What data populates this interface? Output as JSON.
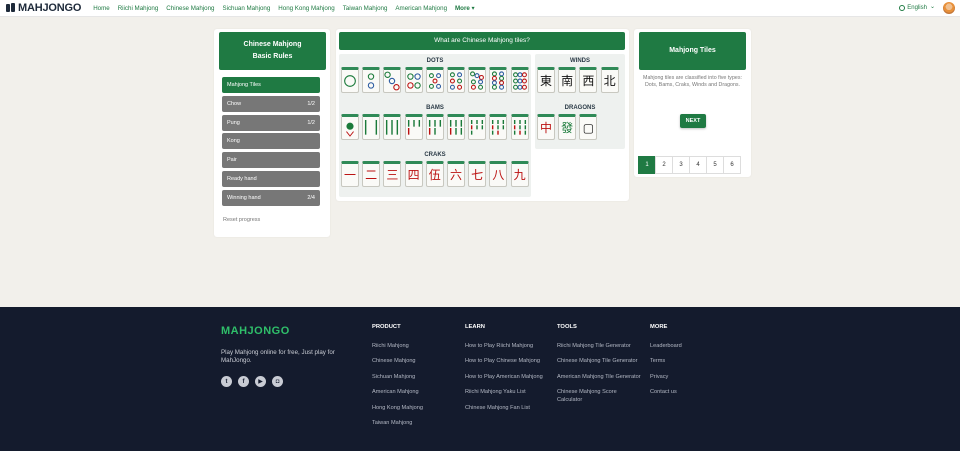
{
  "nav": {
    "brand": "MAHJONGO",
    "links": [
      "Home",
      "Riichi Mahjong",
      "Chinese Mahjong",
      "Sichuan Mahjong",
      "Hong Kong Mahjong",
      "Taiwan Mahjong",
      "American Mahjong",
      "More ▾"
    ],
    "language": "English",
    "language_arrow": "⌄"
  },
  "left": {
    "title_line1": "Chinese Mahjong",
    "title_line2": "Basic Rules",
    "items": [
      {
        "label": "Mahjong Tiles",
        "progress": ""
      },
      {
        "label": "Chow",
        "progress": "1/2"
      },
      {
        "label": "Pung",
        "progress": "1/2"
      },
      {
        "label": "Kong",
        "progress": ""
      },
      {
        "label": "Pair",
        "progress": ""
      },
      {
        "label": "Ready hand",
        "progress": ""
      },
      {
        "label": "Winning hand",
        "progress": "2/4"
      }
    ],
    "reset": "Reset progress"
  },
  "center": {
    "title": "What are Chinese Mahjong tiles?",
    "dots_title": "DOTS",
    "winds_title": "WINDS",
    "bams_title": "BAMS",
    "dragons_title": "DRAGONS",
    "craks_title": "CRAKS",
    "dots": [
      "1",
      "2",
      "3",
      "4",
      "5",
      "6",
      "7",
      "8",
      "9"
    ],
    "bams": [
      "1",
      "2",
      "3",
      "4",
      "5",
      "6",
      "7",
      "8",
      "9"
    ],
    "craks": [
      "一",
      "二",
      "三",
      "四",
      "伍",
      "六",
      "七",
      "八",
      "九"
    ],
    "winds": [
      "東",
      "南",
      "西",
      "北"
    ],
    "dragons": [
      "中",
      "發",
      "▢"
    ]
  },
  "right": {
    "title": "Mahjong Tiles",
    "description": "Mahjong tiles are classified into five types: Dots, Bams, Craks, Winds and Dragons.",
    "next": "NEXT",
    "pages": [
      "1",
      "2",
      "3",
      "4",
      "5",
      "6"
    ]
  },
  "footer": {
    "brand": "MAHJONGO",
    "tagline": "Play Mahjong online for free, Just play for MahJongo.",
    "social": [
      "t",
      "f",
      "▶",
      "◘"
    ],
    "columns": [
      {
        "title": "PRODUCT",
        "links": [
          "Riichi Mahjong",
          "Chinese Mahjong",
          "Sichuan Mahjong",
          "American Mahjong",
          "Hong Kong Mahjong",
          "Taiwan Mahjong"
        ]
      },
      {
        "title": "LEARN",
        "links": [
          "How to Play Riichi Mahjong",
          "How to Play Chinese Mahjong",
          "How to Play American Mahjong",
          "Riichi Mahjong Yaku List",
          "Chinese Mahjong Fan List"
        ]
      },
      {
        "title": "TOOLS",
        "links": [
          "Riichi Mahjong Tile Generator",
          "Chinese Mahjong Tile Generator",
          "American Mahjong Tile Generator",
          "Chinese Mahjong Score Calculator"
        ]
      },
      {
        "title": "MORE",
        "links": [
          "Leaderboard",
          "Terms",
          "Privacy",
          "Contact us"
        ]
      }
    ]
  },
  "colors": {
    "accent": "#1f7a43",
    "footer_bg": "#141b2d",
    "page_bg": "#f2f0eb"
  }
}
